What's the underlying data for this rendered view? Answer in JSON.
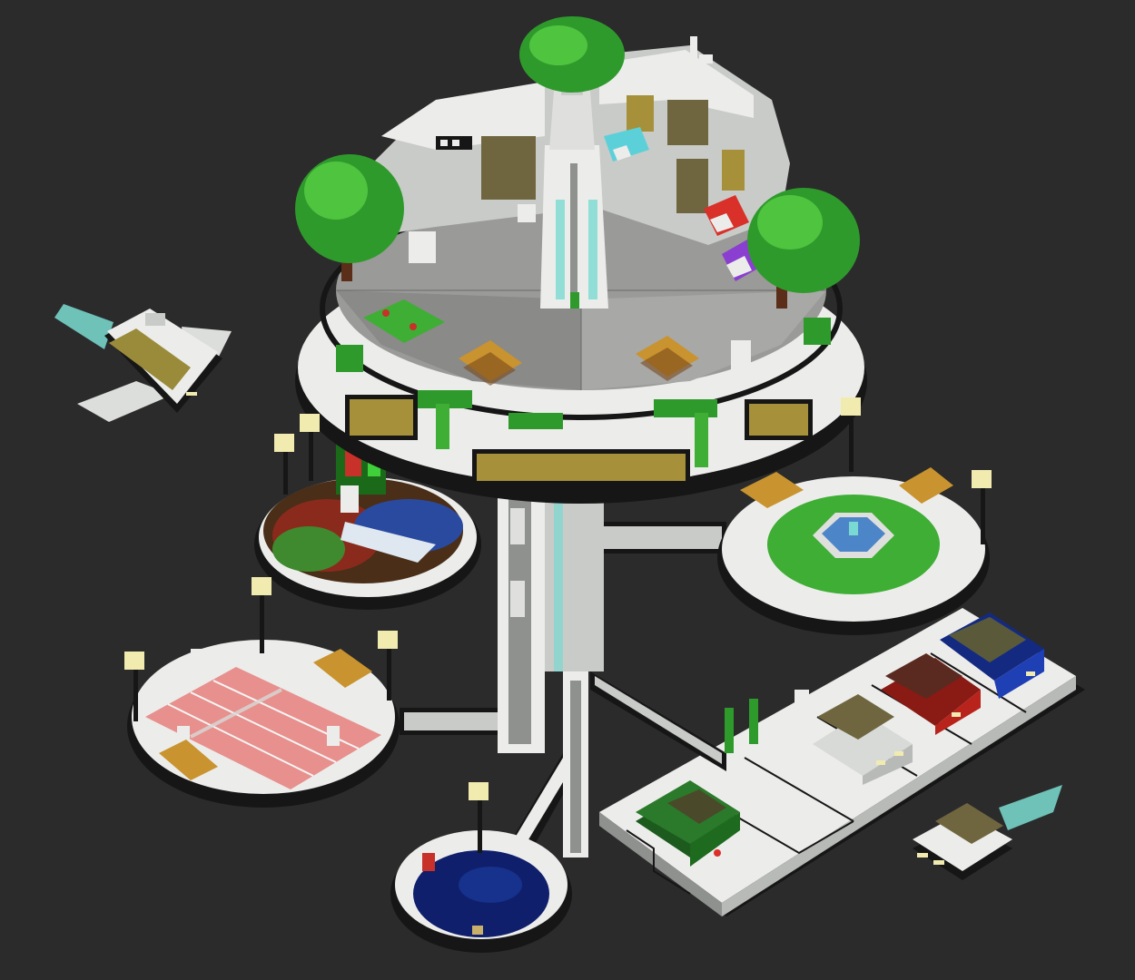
{
  "scene": {
    "background": "#2b2b2b",
    "palette": {
      "white_block": "#ecedeb",
      "light_gray": "#c9cbc8",
      "mid_gray": "#8f918f",
      "plaza_gray": "#9a9a98",
      "dark_edge": "#161616",
      "tree_green": "#2f9a2c",
      "tree_light": "#4fc43f",
      "grass": "#3fae34",
      "glass_yellow": "#a6913a",
      "glass_cyan": "#7ad9d2",
      "lamp": "#f2ebb0",
      "bench": "#c9932f",
      "tennis_court": "#e7908d",
      "pool_blue": "#0f1f6b",
      "fountain_blue": "#4d86c8",
      "car_red": "#b8231c",
      "car_blue": "#1f3fb5",
      "car_green": "#2b7a2b",
      "thruster": "#7fe8dc",
      "awning_red": "#d9302a",
      "awning_cyan": "#5cd0d9",
      "awning_purple": "#8a3fd0"
    },
    "objects": [
      "sky-city-platform",
      "central-tower",
      "trees",
      "garden-pod",
      "fountain-pod",
      "tennis-court-pod",
      "pool-pod",
      "parking-deck",
      "flying-car-left",
      "flying-car-right",
      "street-lamps"
    ]
  }
}
